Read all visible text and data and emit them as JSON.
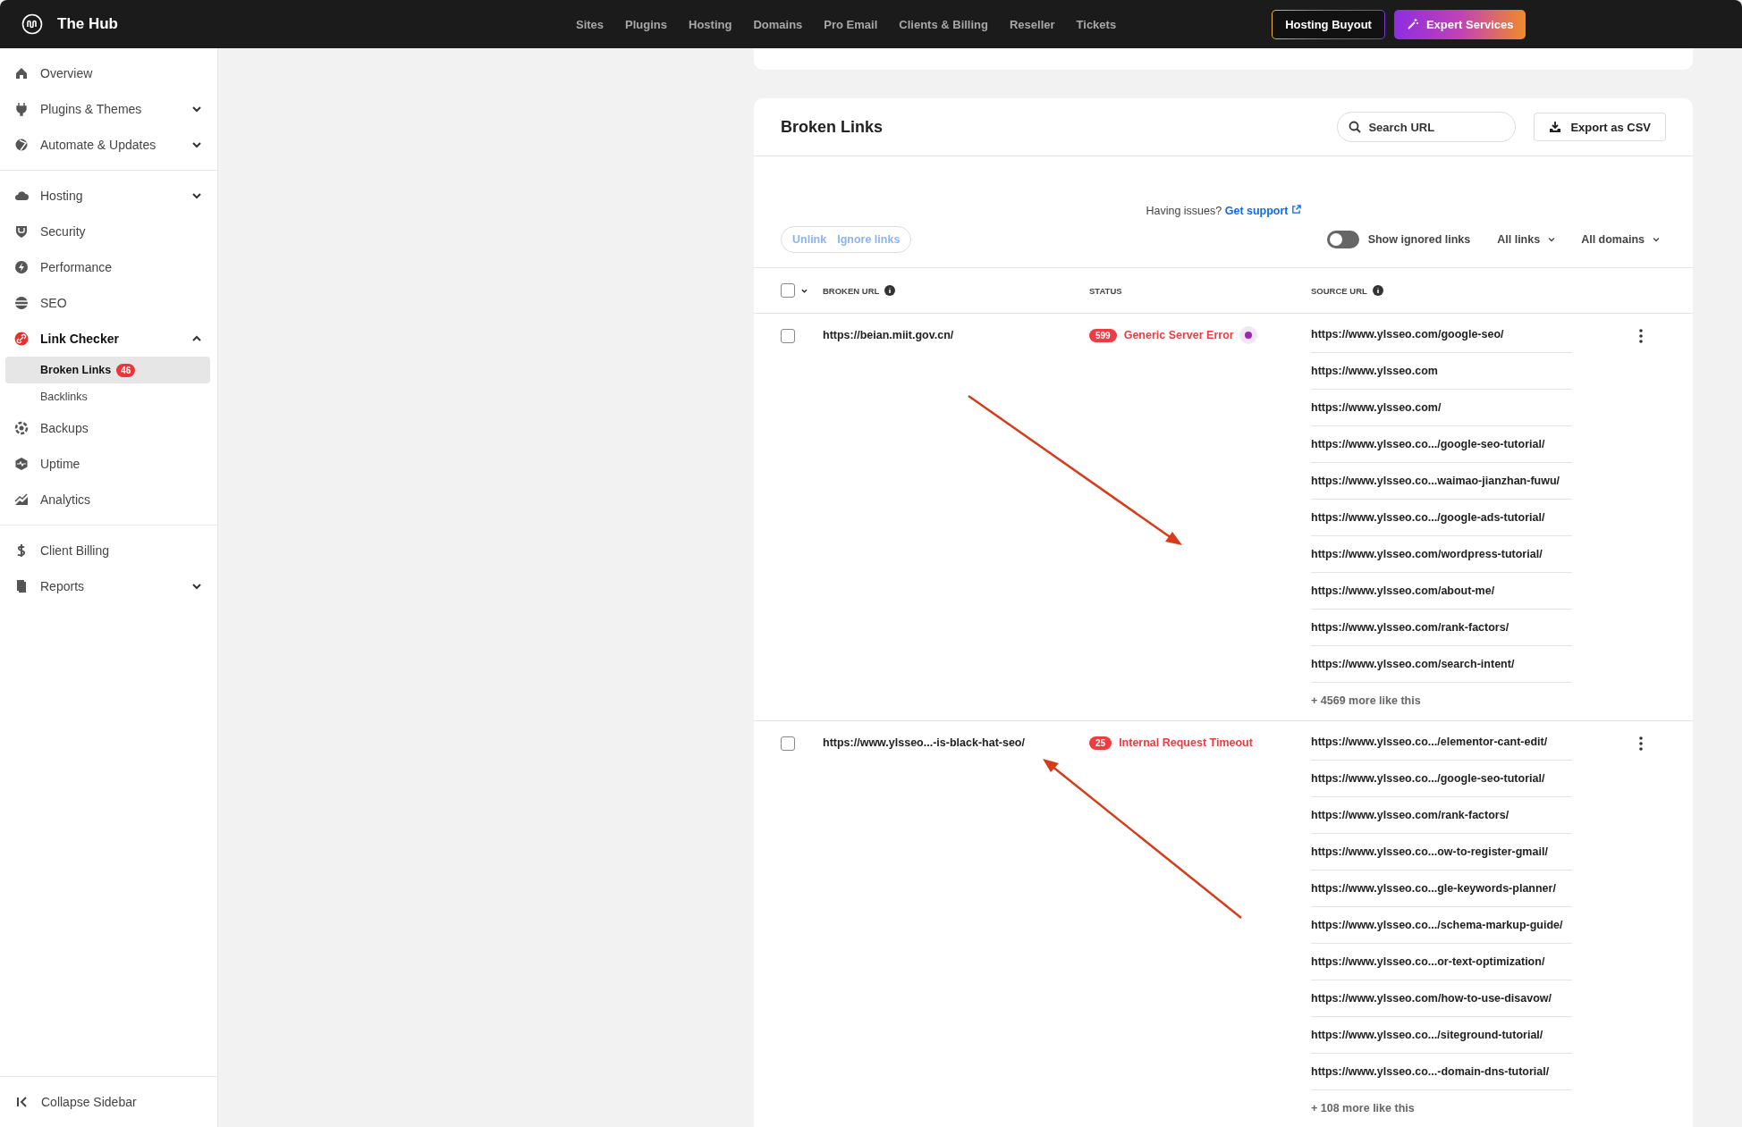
{
  "topbar": {
    "brand": "The Hub",
    "nav": [
      {
        "label": "Sites"
      },
      {
        "label": "Plugins"
      },
      {
        "label": "Hosting"
      },
      {
        "label": "Domains"
      },
      {
        "label": "Pro Email"
      },
      {
        "label": "Clients & Billing"
      },
      {
        "label": "Reseller"
      },
      {
        "label": "Tickets"
      }
    ],
    "buttons": [
      {
        "label": "Hosting Buyout",
        "kind": "outline"
      },
      {
        "label": "Expert Services",
        "kind": "gradient"
      }
    ]
  },
  "sidebar": {
    "groups": [
      [
        {
          "label": "Overview",
          "selected": false
        },
        {
          "label": "Plugins & Themes",
          "selected": false,
          "expanded": false
        },
        {
          "label": "Automate & Updates",
          "selected": false,
          "expanded": false
        }
      ],
      [
        {
          "label": "Hosting",
          "selected": false,
          "expanded": false
        },
        {
          "label": "Security",
          "selected": false
        },
        {
          "label": "Performance",
          "selected": false
        },
        {
          "label": "SEO",
          "selected": false
        },
        {
          "label": "Link Checker",
          "selected": true,
          "expanded": true,
          "children": [
            {
              "label": "Broken Links",
              "selected": true,
              "badge": "46"
            },
            {
              "label": "Backlinks",
              "selected": false
            }
          ]
        },
        {
          "label": "Backups",
          "selected": false
        },
        {
          "label": "Uptime",
          "selected": false
        },
        {
          "label": "Analytics",
          "selected": false
        }
      ],
      [
        {
          "label": "Client Billing",
          "selected": false
        },
        {
          "label": "Reports",
          "selected": false,
          "expanded": false
        }
      ]
    ],
    "collapse": "Collapse Sidebar"
  },
  "card": {
    "title": "Broken Links",
    "search": {
      "placeholder": "Search URL"
    },
    "export": "Export as CSV",
    "help": {
      "text": "Having issues?",
      "link": "Get support"
    },
    "bulk_actions": [
      {
        "label": "Unlink",
        "disabled": true
      },
      {
        "label": "Ignore links",
        "disabled": true
      }
    ],
    "toggle": {
      "label": "Show ignored links",
      "on": false
    },
    "filters": [
      {
        "label": "All links"
      },
      {
        "label": "All domains"
      }
    ],
    "table": {
      "select_all": {
        "checked": false
      },
      "columns": [
        {
          "label": "BROKEN URL",
          "info": true
        },
        {
          "label": "STATUS",
          "info": false
        },
        {
          "label": "SOURCE URL",
          "info": true
        }
      ],
      "rows": [
        {
          "checked": false,
          "url": "https://beian.miit.gov.cn/",
          "status": {
            "code": "599",
            "text": "Generic Server Error",
            "indicator": {
              "color": "#9c27b0"
            }
          },
          "sources": [
            "https://www.ylsseo.com/google-seo/",
            "https://www.ylsseo.com",
            "https://www.ylsseo.com/",
            "https://www.ylsseo.co.../google-seo-tutorial/",
            "https://www.ylsseo.co...waimao-jianzhan-fuwu/",
            "https://www.ylsseo.co.../google-ads-tutorial/",
            "https://www.ylsseo.com/wordpress-tutorial/",
            "https://www.ylsseo.com/about-me/",
            "https://www.ylsseo.com/rank-factors/",
            "https://www.ylsseo.com/search-intent/"
          ],
          "more": "+ 4569 more like this"
        },
        {
          "checked": false,
          "url": "https://www.ylsseo...-is-black-hat-seo/",
          "status": {
            "code": "25",
            "text": "Internal Request Timeout"
          },
          "sources": [
            "https://www.ylsseo.co.../elementor-cant-edit/",
            "https://www.ylsseo.co.../google-seo-tutorial/",
            "https://www.ylsseo.com/rank-factors/",
            "https://www.ylsseo.co...ow-to-register-gmail/",
            "https://www.ylsseo.co...gle-keywords-planner/",
            "https://www.ylsseo.co.../schema-markup-guide/",
            "https://www.ylsseo.co...or-text-optimization/",
            "https://www.ylsseo.com/how-to-use-disavow/",
            "https://www.ylsseo.co.../siteground-tutorial/",
            "https://www.ylsseo.co...-domain-dns-tutorial/"
          ],
          "more": "+ 108 more like this"
        }
      ]
    }
  }
}
